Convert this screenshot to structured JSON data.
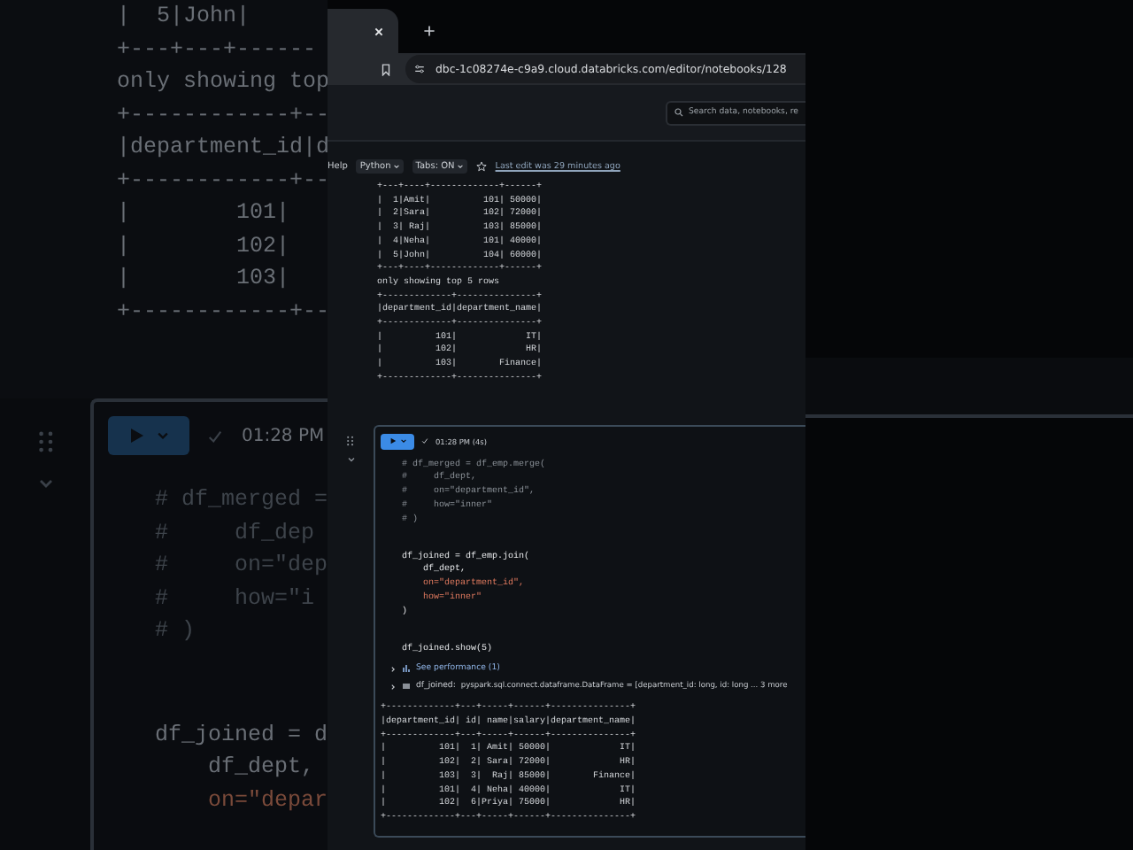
{
  "backdrop": {
    "output_lines": [
      "|  5|John|",
      "+---+---+------",
      "only showing top",
      "+------------+--",
      "|department_id|d",
      "+------------+--",
      "|        101|",
      "|        102|",
      "|        103|",
      "+------------+--"
    ],
    "cell": {
      "run_time": "01:28 PM",
      "code_blocks": [
        [
          {
            "text": "# df_merged =",
            "kind": "comment"
          },
          {
            "text": "#     df_dep",
            "kind": "comment"
          },
          {
            "text": "#     on=\"dep",
            "kind": "comment"
          },
          {
            "text": "#     how=\"i",
            "kind": "comment"
          },
          {
            "text": "# )",
            "kind": "comment"
          }
        ],
        [
          {
            "text": "df_joined = d",
            "kind": "code"
          },
          {
            "text": "    df_dept,",
            "kind": "code"
          },
          {
            "text": "    on=\"depar",
            "kind": "arg"
          }
        ]
      ]
    }
  },
  "browser": {
    "url": "dbc-1c08274e-c9a9.cloud.databricks.com/editor/notebooks/128",
    "search": {
      "placeholder": "Search data, notebooks, re"
    }
  },
  "toolbar": {
    "help": "Help",
    "language": "Python",
    "tabs": "Tabs: ON",
    "last_edit": "Last edit was 29 minutes ago"
  },
  "previous_output": [
    "+---+----+-------------+------+",
    "|  1|Amit|          101| 50000|",
    "|  2|Sara|          102| 72000|",
    "|  3| Raj|          103| 85000|",
    "|  4|Neha|          101| 40000|",
    "|  5|John|          104| 60000|",
    "+---+----+-------------+------+",
    "only showing top 5 rows",
    "+-------------+---------------+",
    "|department_id|department_name|",
    "+-------------+---------------+",
    "|          101|             IT|",
    "|          102|             HR|",
    "|          103|        Finance|",
    "+-------------+---------------+"
  ],
  "cell": {
    "run_time": "01:28 PM (4s)",
    "code_blocks": [
      [
        {
          "text": "# df_merged = df_emp.merge(",
          "kind": "comment"
        },
        {
          "text": "#     df_dept,",
          "kind": "comment"
        },
        {
          "text": "#     on=\"department_id\",",
          "kind": "comment"
        },
        {
          "text": "#     how=\"inner\"",
          "kind": "comment"
        },
        {
          "text": "# )",
          "kind": "comment"
        }
      ],
      [
        {
          "text": "df_joined = df_emp.join(",
          "kind": "code"
        },
        {
          "text": "    df_dept,",
          "kind": "code"
        },
        {
          "text": "    on=\"department_id\",",
          "kind": "arg"
        },
        {
          "text": "    how=\"inner\"",
          "kind": "arg"
        },
        {
          "text": ")",
          "kind": "code"
        }
      ],
      [
        {
          "text": "df_joined.show(5)",
          "kind": "code"
        }
      ]
    ],
    "performance": "See performance (1)",
    "variable": {
      "name": "df_joined:",
      "type": "pyspark.sql.connect.dataframe.DataFrame = [department_id: long, id: long ... 3 more"
    },
    "output": [
      "+-------------+---+-----+------+---------------+",
      "|department_id| id| name|salary|department_name|",
      "+-------------+---+-----+------+---------------+",
      "|          101|  1| Amit| 50000|             IT|",
      "|          102|  2| Sara| 72000|             HR|",
      "|          103|  3|  Raj| 85000|        Finance|",
      "|          101|  4| Neha| 40000|             IT|",
      "|          102|  6|Priya| 75000|             HR|",
      "+-------------+---+-----+------+---------------+"
    ]
  }
}
